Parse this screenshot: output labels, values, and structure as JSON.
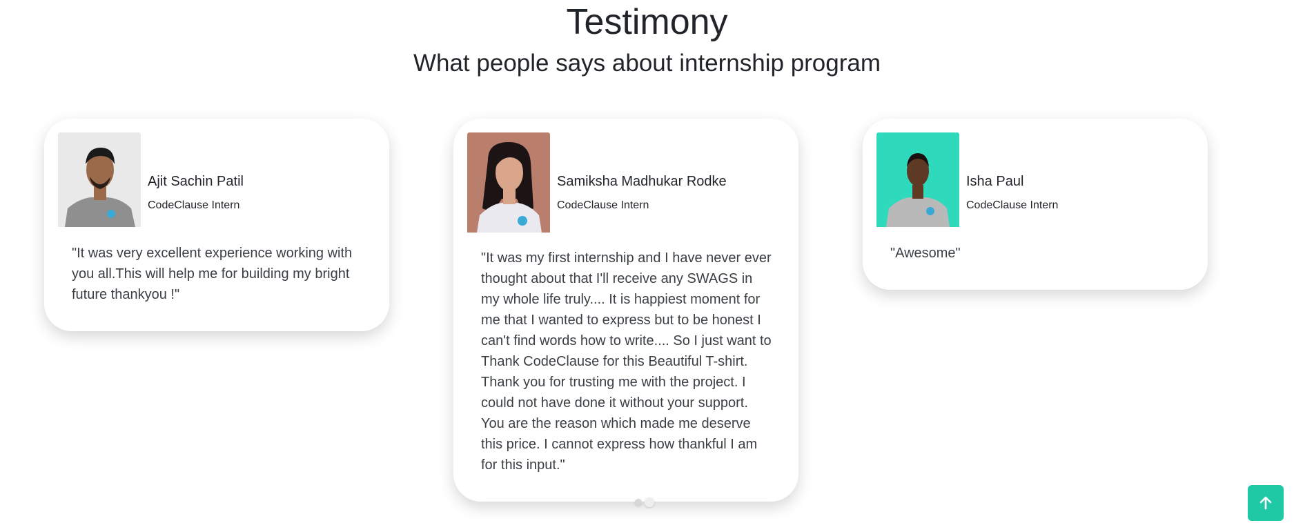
{
  "section": {
    "title": "Testimony",
    "subtitle": "What people says about internship program"
  },
  "testimonials": [
    {
      "name": "Ajit Sachin Patil",
      "role": "CodeClause Intern",
      "quote": "\"It was very excellent experience working with you all.This will help me for building my bright future thankyou !\"",
      "photo": {
        "background": "#e9e9e9",
        "shirt": "#8f8f8f",
        "skin": "#9a6a4b",
        "hair": "#1a1a1a"
      }
    },
    {
      "name": "Samiksha Madhukar Rodke",
      "role": "CodeClause Intern",
      "quote": "\"It was my first internship and I have never ever thought about that I'll receive any SWAGS in my whole life truly.... It is happiest moment for me that I wanted to express but to be honest I can't find words how to write.... So I just want to Thank CodeClause for this Beautiful T-shirt. Thank you for trusting me with the project. I could not have done it without your support. You are the reason which made me deserve this price. I cannot express how thankful I am for this input.\"",
      "photo": {
        "background": "#b97e6c",
        "shirt": "#e9e9ef",
        "skin": "#d9a58b",
        "hair": "#1c1414"
      }
    },
    {
      "name": "Isha Paul",
      "role": "CodeClause Intern",
      "quote": "\"Awesome\"",
      "photo": {
        "background": "#2fd9bc",
        "shirt": "#b9b9b9",
        "skin": "#5e3a25",
        "hair": "#1a1010"
      }
    }
  ],
  "carousel": {
    "dots": 2,
    "active_index": 1
  },
  "back_to_top": {
    "icon": "arrow-up-icon",
    "color": "#20c9a6"
  }
}
